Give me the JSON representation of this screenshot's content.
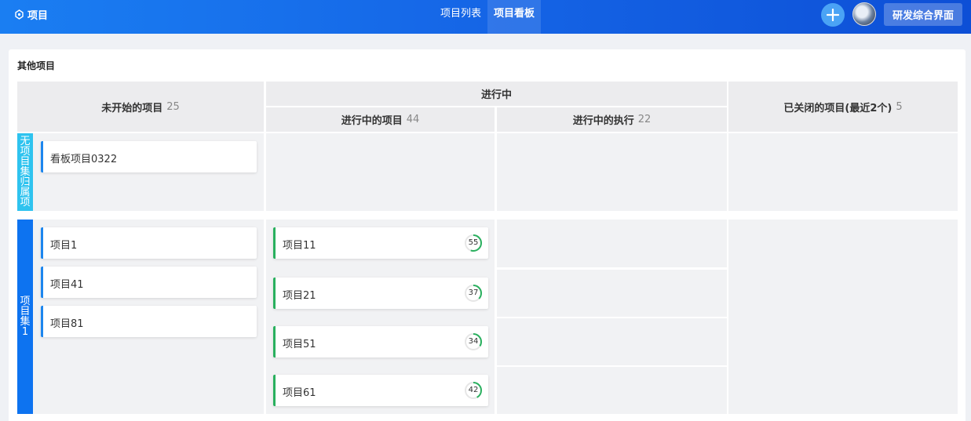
{
  "header": {
    "brand_label": "项目",
    "tabs": [
      "项目列表",
      "项目看板"
    ],
    "active_tab": 1,
    "switch_label": "研发综合界面"
  },
  "board": {
    "title": "其他项目",
    "in_progress_group": "进行中",
    "columns": [
      {
        "label": "未开始的项目",
        "count": "25"
      },
      {
        "label": "进行中的项目",
        "count": "44"
      },
      {
        "label": "进行中的执行",
        "count": "22"
      },
      {
        "label": "已关闭的项目(最近2个)",
        "count": "5"
      }
    ],
    "rows": [
      {
        "label": "无项目集归属项",
        "color": "#2ec3ef",
        "not_started": [
          "看板项目0322"
        ]
      },
      {
        "label": "项目集1",
        "color": "#0d73f0",
        "not_started": [
          "项目1",
          "项目41",
          "项目81"
        ],
        "in_progress": [
          {
            "name": "项目11",
            "progress": 55
          },
          {
            "name": "项目21",
            "progress": 37
          },
          {
            "name": "项目51",
            "progress": 34
          },
          {
            "name": "项目61",
            "progress": 42
          }
        ]
      }
    ]
  },
  "colors": {
    "header_start": "#1a7ef2",
    "header_end": "#0d4fd6",
    "card_blue": "#1c86ee",
    "card_green": "#29b05e",
    "progress_green": "#29b05e"
  }
}
